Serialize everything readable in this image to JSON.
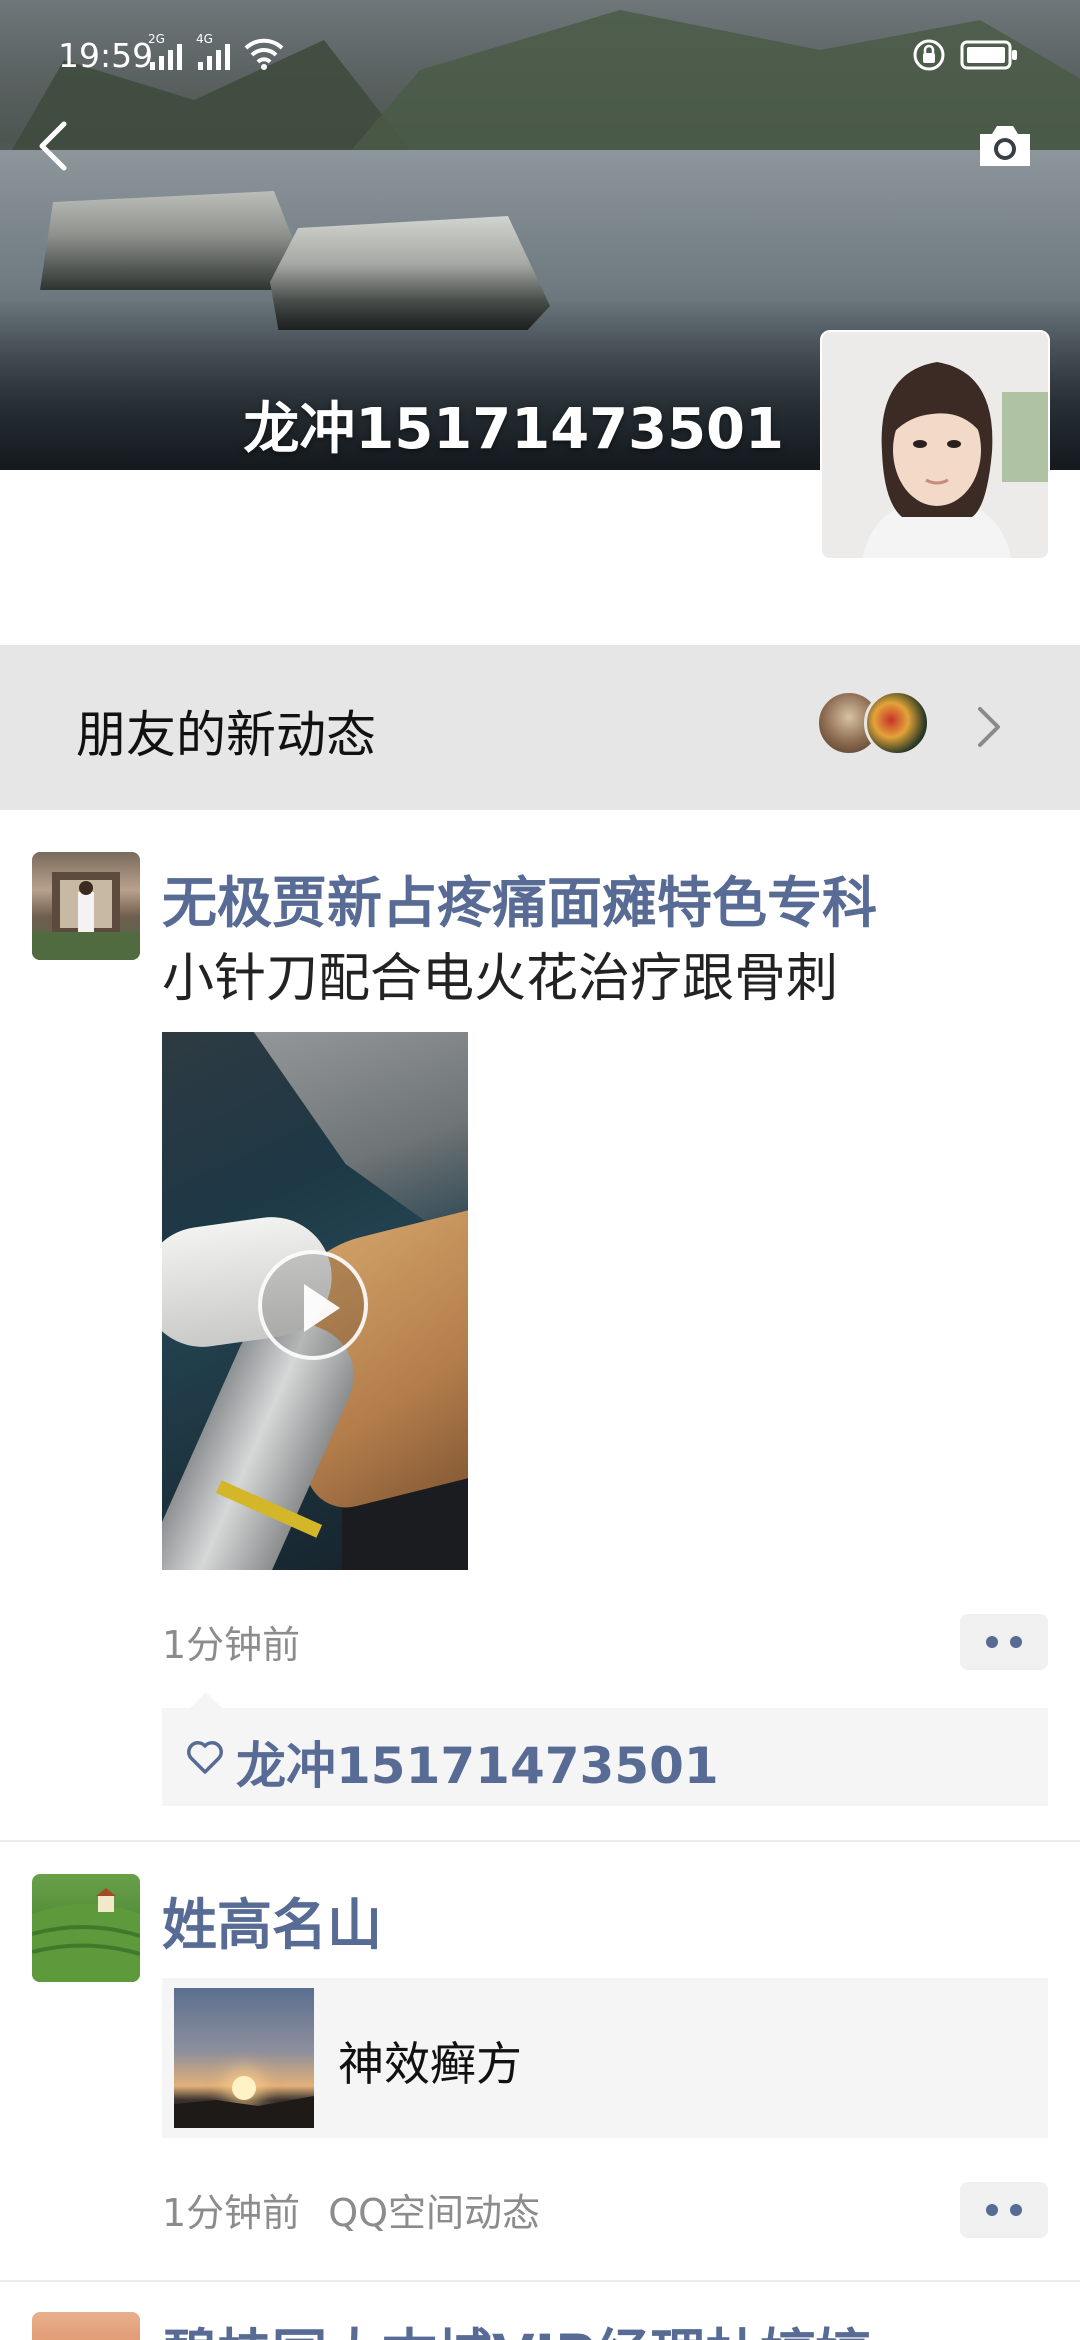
{
  "status_bar": {
    "time": "19:59",
    "network_1": "2G",
    "network_2": "4G"
  },
  "header": {
    "profile_name": "龙冲15171473501",
    "back_icon": "back-arrow-icon",
    "camera_icon": "camera-icon"
  },
  "news": {
    "title": "朋友的新动态"
  },
  "feed": [
    {
      "author": "无极贾新占疼痛面瘫特色专科",
      "text": "小针刀配合电火花治疗跟骨刺",
      "media": "video",
      "time": "1分钟前",
      "likes": [
        "龙冲15171473501"
      ]
    },
    {
      "author": "姓高名山",
      "link_title": "神效癣方",
      "time": "1分钟前",
      "source": "QQ空间动态"
    },
    {
      "author": "碧桂园太古城VIP经理杜婷婷"
    }
  ],
  "colors": {
    "link_blue": "#576b95",
    "meta_gray": "#8c8c8c",
    "bar_gray": "#e6e6e6"
  }
}
